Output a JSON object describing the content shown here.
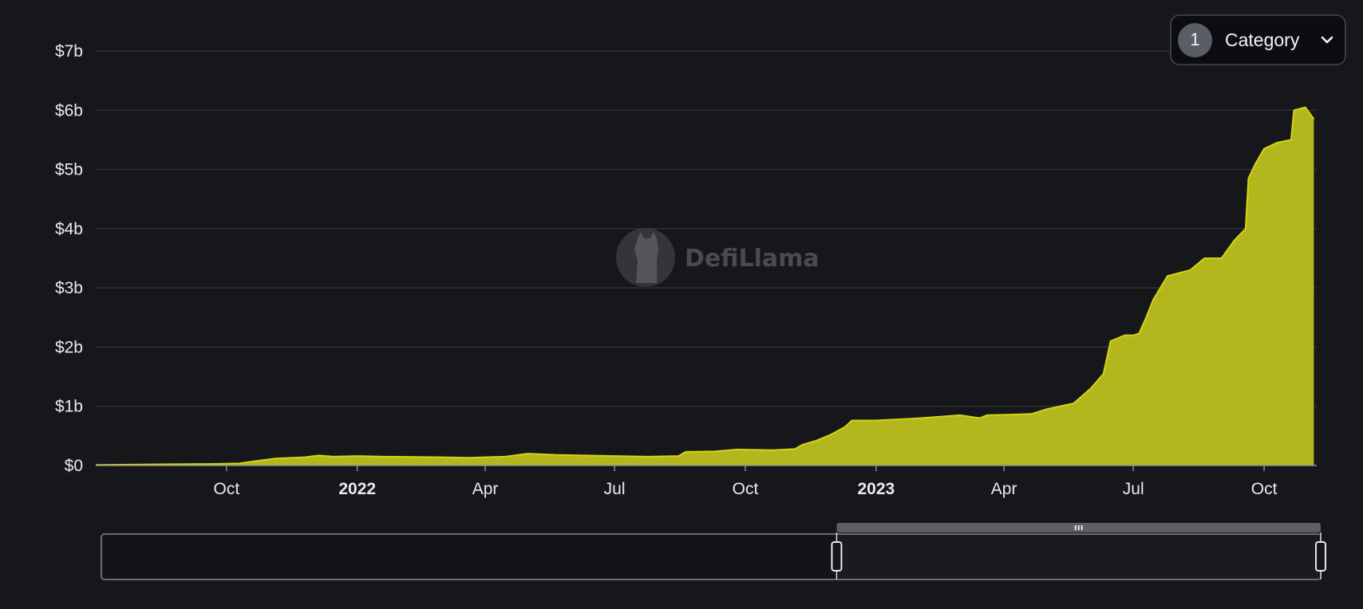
{
  "filter": {
    "count": "1",
    "label": "Category",
    "icon": "chevron-down-icon"
  },
  "watermark": {
    "text": "DefiLlama",
    "icon": "llama-logo-icon"
  },
  "colors": {
    "accent": "#d4d414",
    "fill": "#b9bd1e",
    "background": "#16171b",
    "grid": "#2e3036"
  },
  "chart_data": {
    "type": "area",
    "title": "",
    "xlabel": "",
    "ylabel": "",
    "y_unit": "USD",
    "ylim": [
      0,
      7000000000
    ],
    "xlim": [
      "2021-07-01",
      "2023-11-07"
    ],
    "grid": true,
    "legend": "none",
    "y_ticks": [
      {
        "value": 0,
        "label": "$0"
      },
      {
        "value": 1000000000,
        "label": "$1b"
      },
      {
        "value": 2000000000,
        "label": "$2b"
      },
      {
        "value": 3000000000,
        "label": "$3b"
      },
      {
        "value": 4000000000,
        "label": "$4b"
      },
      {
        "value": 5000000000,
        "label": "$5b"
      },
      {
        "value": 6000000000,
        "label": "$6b"
      },
      {
        "value": 7000000000,
        "label": "$7b"
      }
    ],
    "x_ticks": [
      {
        "date": "2021-10-01",
        "label": "Oct",
        "bold": false
      },
      {
        "date": "2022-01-01",
        "label": "2022",
        "bold": true
      },
      {
        "date": "2022-04-01",
        "label": "Apr",
        "bold": false
      },
      {
        "date": "2022-07-01",
        "label": "Jul",
        "bold": false
      },
      {
        "date": "2022-10-01",
        "label": "Oct",
        "bold": false
      },
      {
        "date": "2023-01-01",
        "label": "2023",
        "bold": true
      },
      {
        "date": "2023-04-01",
        "label": "Apr",
        "bold": false
      },
      {
        "date": "2023-07-01",
        "label": "Jul",
        "bold": false
      },
      {
        "date": "2023-10-01",
        "label": "Oct",
        "bold": false
      }
    ],
    "series": [
      {
        "points": [
          [
            "2021-07-01",
            10000000
          ],
          [
            "2021-08-15",
            20000000
          ],
          [
            "2021-09-20",
            25000000
          ],
          [
            "2021-10-10",
            35000000
          ],
          [
            "2021-10-20",
            70000000
          ],
          [
            "2021-11-05",
            120000000
          ],
          [
            "2021-11-25",
            140000000
          ],
          [
            "2021-12-05",
            170000000
          ],
          [
            "2021-12-15",
            150000000
          ],
          [
            "2022-01-01",
            160000000
          ],
          [
            "2022-01-20",
            150000000
          ],
          [
            "2022-02-10",
            145000000
          ],
          [
            "2022-03-01",
            140000000
          ],
          [
            "2022-03-20",
            130000000
          ],
          [
            "2022-04-15",
            150000000
          ],
          [
            "2022-05-01",
            200000000
          ],
          [
            "2022-05-20",
            180000000
          ],
          [
            "2022-06-10",
            170000000
          ],
          [
            "2022-07-01",
            160000000
          ],
          [
            "2022-07-25",
            150000000
          ],
          [
            "2022-08-15",
            160000000
          ],
          [
            "2022-08-20",
            230000000
          ],
          [
            "2022-09-10",
            240000000
          ],
          [
            "2022-09-25",
            270000000
          ],
          [
            "2022-10-20",
            260000000
          ],
          [
            "2022-11-05",
            280000000
          ],
          [
            "2022-11-10",
            350000000
          ],
          [
            "2022-11-20",
            420000000
          ],
          [
            "2022-11-30",
            520000000
          ],
          [
            "2022-12-10",
            650000000
          ],
          [
            "2022-12-15",
            760000000
          ],
          [
            "2023-01-01",
            760000000
          ],
          [
            "2023-02-01",
            800000000
          ],
          [
            "2023-03-01",
            850000000
          ],
          [
            "2023-03-15",
            800000000
          ],
          [
            "2023-03-20",
            850000000
          ],
          [
            "2023-04-20",
            870000000
          ],
          [
            "2023-05-01",
            950000000
          ],
          [
            "2023-05-20",
            1050000000
          ],
          [
            "2023-06-01",
            1300000000
          ],
          [
            "2023-06-10",
            1550000000
          ],
          [
            "2023-06-15",
            2100000000
          ],
          [
            "2023-06-25",
            2200000000
          ],
          [
            "2023-07-01",
            2200000000
          ],
          [
            "2023-07-05",
            2230000000
          ],
          [
            "2023-07-10",
            2500000000
          ],
          [
            "2023-07-15",
            2800000000
          ],
          [
            "2023-07-25",
            3200000000
          ],
          [
            "2023-08-10",
            3300000000
          ],
          [
            "2023-08-20",
            3500000000
          ],
          [
            "2023-09-01",
            3500000000
          ],
          [
            "2023-09-10",
            3800000000
          ],
          [
            "2023-09-18",
            4000000000
          ],
          [
            "2023-09-20",
            4850000000
          ],
          [
            "2023-09-25",
            5100000000
          ],
          [
            "2023-10-01",
            5350000000
          ],
          [
            "2023-10-10",
            5450000000
          ],
          [
            "2023-10-20",
            5500000000
          ],
          [
            "2023-10-22",
            6000000000
          ],
          [
            "2023-10-30",
            6050000000
          ],
          [
            "2023-11-05",
            5850000000
          ]
        ]
      }
    ],
    "zoom_range": [
      "2022-12-01",
      "2023-11-07"
    ]
  }
}
